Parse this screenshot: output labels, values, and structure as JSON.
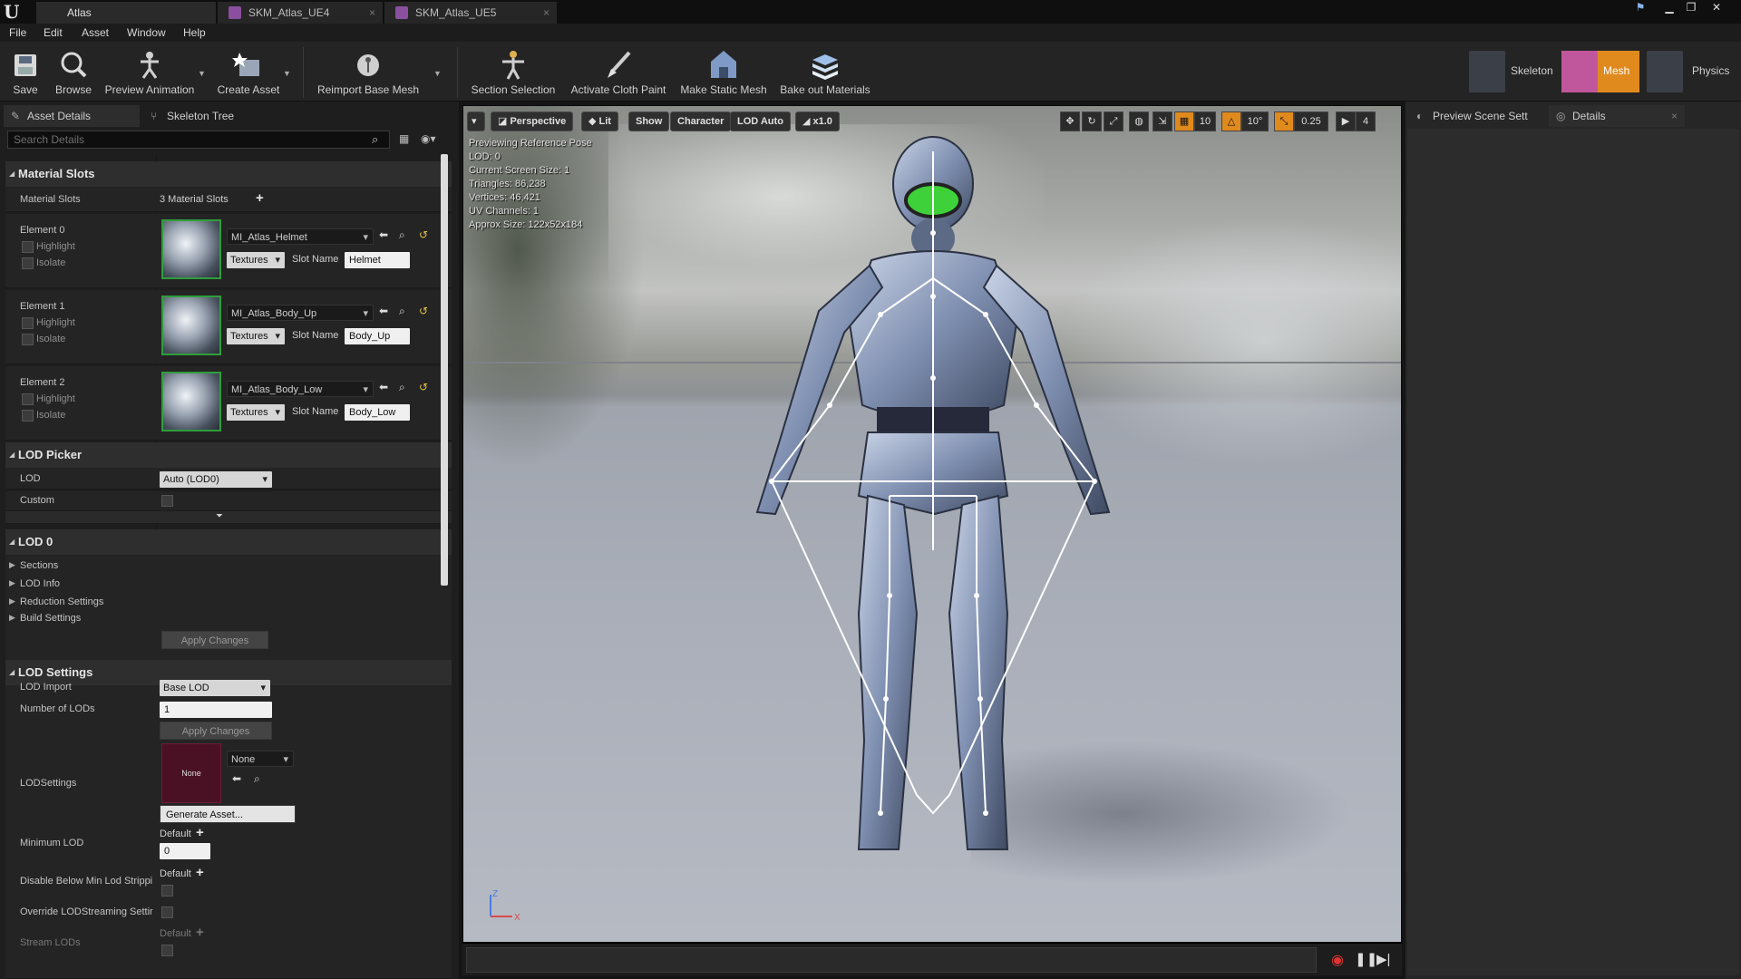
{
  "titlebar": {
    "tabs": [
      {
        "label": "Atlas"
      },
      {
        "label": "SKM_Atlas_UE4"
      },
      {
        "label": "SKM_Atlas_UE5"
      }
    ]
  },
  "menu": [
    "File",
    "Edit",
    "Asset",
    "Window",
    "Help"
  ],
  "toolbar": {
    "buttons": [
      {
        "label": "Save",
        "icon": "save-icon"
      },
      {
        "label": "Browse",
        "icon": "browse-icon"
      },
      {
        "label": "Preview Animation",
        "icon": "preview-animation-icon"
      },
      {
        "label": "Create Asset",
        "icon": "create-asset-icon"
      },
      {
        "label": "Reimport Base Mesh",
        "icon": "reimport-icon"
      },
      {
        "label": "Section Selection",
        "icon": "section-selection-icon"
      },
      {
        "label": "Activate Cloth Paint",
        "icon": "cloth-paint-icon"
      },
      {
        "label": "Make Static Mesh",
        "icon": "static-mesh-icon"
      },
      {
        "label": "Bake out Materials",
        "icon": "bake-materials-icon"
      }
    ],
    "modes": [
      {
        "label": "Skeleton"
      },
      {
        "label": "Mesh",
        "active": true
      },
      {
        "label": "Physics"
      }
    ]
  },
  "left_panel": {
    "tabs": [
      {
        "label": "Asset Details"
      },
      {
        "label": "Skeleton Tree"
      }
    ],
    "search_placeholder": "Search Details",
    "material_slots": {
      "category": "Material Slots",
      "label": "Material Slots",
      "count": "3 Material Slots",
      "elements": [
        {
          "label": "Element 0",
          "highlight": "Highlight",
          "isolate": "Isolate",
          "material": "MI_Atlas_Helmet",
          "textures": "Textures",
          "slot_name_label": "Slot Name",
          "slot_name": "Helmet"
        },
        {
          "label": "Element 1",
          "highlight": "Highlight",
          "isolate": "Isolate",
          "material": "MI_Atlas_Body_Up",
          "textures": "Textures",
          "slot_name_label": "Slot Name",
          "slot_name": "Body_Up"
        },
        {
          "label": "Element 2",
          "highlight": "Highlight",
          "isolate": "Isolate",
          "material": "MI_Atlas_Body_Low",
          "textures": "Textures",
          "slot_name_label": "Slot Name",
          "slot_name": "Body_Low"
        }
      ]
    },
    "lod_picker": {
      "category": "LOD Picker",
      "lod_label": "LOD",
      "lod_value": "Auto (LOD0)",
      "custom_label": "Custom"
    },
    "lod0": {
      "category": "LOD 0",
      "items": [
        "Sections",
        "LOD Info",
        "Reduction Settings",
        "Build Settings"
      ],
      "apply": "Apply Changes"
    },
    "lod_settings": {
      "category": "LOD Settings",
      "lod_import_label": "LOD Import",
      "lod_import_value": "Base LOD",
      "num_lods_label": "Number of LODs",
      "num_lods_value": "1",
      "apply": "Apply Changes",
      "lodsettings_label": "LODSettings",
      "lodsettings_thumb": "None",
      "lodsettings_value": "None",
      "generate": "Generate Asset...",
      "min_lod_label": "Minimum LOD",
      "min_lod_default": "Default",
      "min_lod_value": "0",
      "disable_below_label": "Disable Below Min Lod Strippi",
      "disable_below_default": "Default",
      "override_label": "Override LODStreaming Settir",
      "stream_lods_label": "Stream LODs",
      "stream_lods_default": "Default"
    }
  },
  "viewport": {
    "buttons": {
      "perspective": "Perspective",
      "lit": "Lit",
      "show": "Show",
      "character": "Character",
      "lod": "LOD Auto",
      "speed": "x1.0"
    },
    "info": [
      "Previewing Reference Pose",
      "LOD: 0",
      "Current Screen Size: 1",
      "Triangles: 86,238",
      "Vertices: 46,421",
      "UV Channels: 1",
      "Approx Size: 122x52x184"
    ],
    "snap": {
      "grid": "10",
      "rotation": "10°",
      "scale": "0.25",
      "camera_speed": "4"
    },
    "axis": {
      "z": "Z",
      "x": "X"
    }
  },
  "right_panel": {
    "tabs": [
      {
        "label": "Preview Scene Sett"
      },
      {
        "label": "Details"
      }
    ]
  },
  "colors": {
    "accent_orange": "#e08a1e",
    "thumb_border_green": "#2f9e3c",
    "visor_green": "#3fd13a"
  }
}
